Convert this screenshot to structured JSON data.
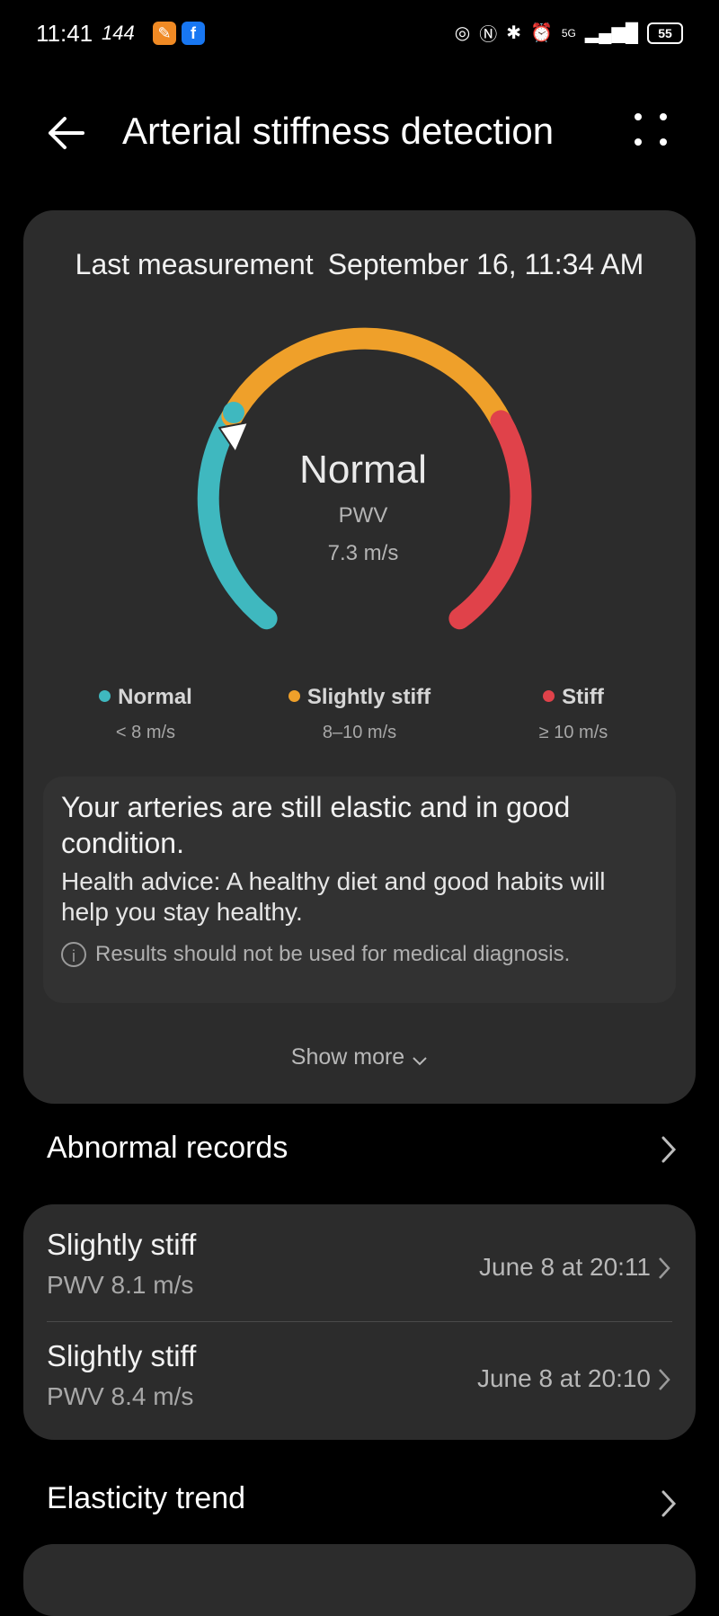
{
  "status_bar": {
    "time": "11:41",
    "refresh_rate": "144",
    "battery": "55",
    "network": "5G"
  },
  "header": {
    "title": "Arterial stiffness detection"
  },
  "measurement": {
    "label": "Last measurement",
    "datetime": "September 16, 11:34 AM",
    "status": "Normal",
    "metric_label": "PWV",
    "metric_value": "7.3 m/s"
  },
  "legend": [
    {
      "label": "Normal",
      "range": "< 8 m/s",
      "color": "#3fb8bf"
    },
    {
      "label": "Slightly stiff",
      "range": "8–10 m/s",
      "color": "#efa02a"
    },
    {
      "label": "Stiff",
      "range": "≥ 10 m/s",
      "color": "#e0424a"
    }
  ],
  "advice": {
    "summary": "Your arteries are still elastic and in good condition.",
    "health_advice": "Health advice: A healthy diet and good habits will help you stay healthy.",
    "disclaimer": "Results should not be used for medical diagnosis."
  },
  "show_more": "Show more",
  "abnormal_records": {
    "title": "Abnormal records",
    "items": [
      {
        "status": "Slightly stiff",
        "pwv": "PWV 8.1 m/s",
        "date": "June 8 at 20:11"
      },
      {
        "status": "Slightly stiff",
        "pwv": "PWV 8.4 m/s",
        "date": "June 8 at 20:10"
      }
    ]
  },
  "elasticity_trend": {
    "title": "Elasticity trend"
  },
  "colors": {
    "normal": "#3fb8bf",
    "slightly_stiff": "#efa02a",
    "stiff": "#e0424a",
    "card": "#2c2c2c"
  }
}
